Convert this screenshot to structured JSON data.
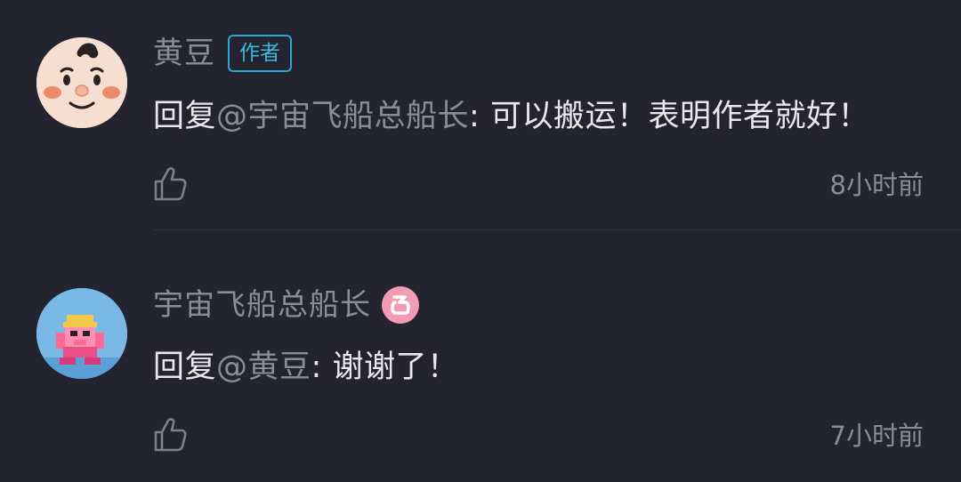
{
  "comments": [
    {
      "username": "黄豆",
      "badge": "作者",
      "reply_prefix": "回复",
      "mention": "@宇宙飞船总船长",
      "colon": ":",
      "text": "可以搬运！表明作者就好！",
      "timestamp": "8小时前",
      "avatar_icon": "emoji-face-avatar",
      "like_icon": "thumbs-up-icon"
    },
    {
      "username": "宇宙飞船总船长",
      "level_badge_icon": "pink-level-6-badge",
      "level_badge_color": "#f29bb5",
      "reply_prefix": "回复",
      "mention": "@黄豆",
      "colon": ":",
      "text": "谢谢了！",
      "timestamp": "7小时前",
      "avatar_icon": "pixel-character-avatar",
      "like_icon": "thumbs-up-icon"
    }
  ],
  "colors": {
    "background": "#23242f",
    "secondary_text": "#8a8c97",
    "primary_text": "#e8e8ec",
    "author_badge": "#3ab8e2"
  }
}
